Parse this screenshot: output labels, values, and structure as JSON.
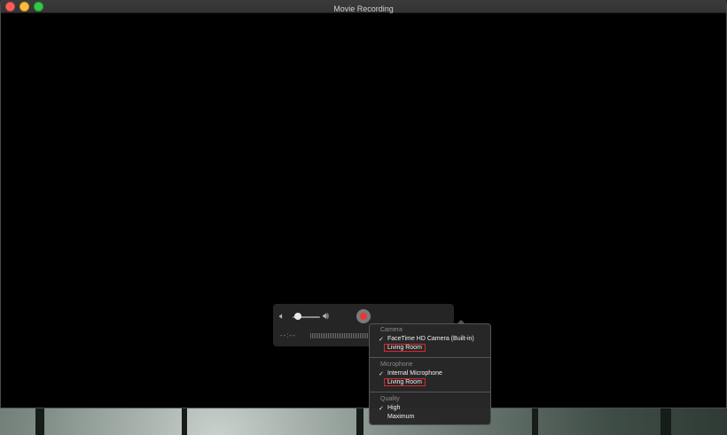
{
  "window": {
    "title": "Movie Recording"
  },
  "hud": {
    "time": "--:--",
    "volume_level": 0.2,
    "record_color": "#e5393c"
  },
  "options_menu": {
    "camera": {
      "heading": "Camera",
      "items": [
        {
          "label": "FaceTime HD Camera (Built-in)",
          "checked": true
        },
        {
          "label": "Living Room",
          "checked": false
        }
      ]
    },
    "microphone": {
      "heading": "Microphone",
      "items": [
        {
          "label": "Internal Microphone",
          "checked": true
        },
        {
          "label": "Living Room",
          "checked": false
        }
      ]
    },
    "quality": {
      "heading": "Quality",
      "items": [
        {
          "label": "High",
          "checked": true
        },
        {
          "label": "Maximum",
          "checked": false
        }
      ]
    },
    "check_glyph": "✓",
    "highlight_color": "#e0262b"
  }
}
